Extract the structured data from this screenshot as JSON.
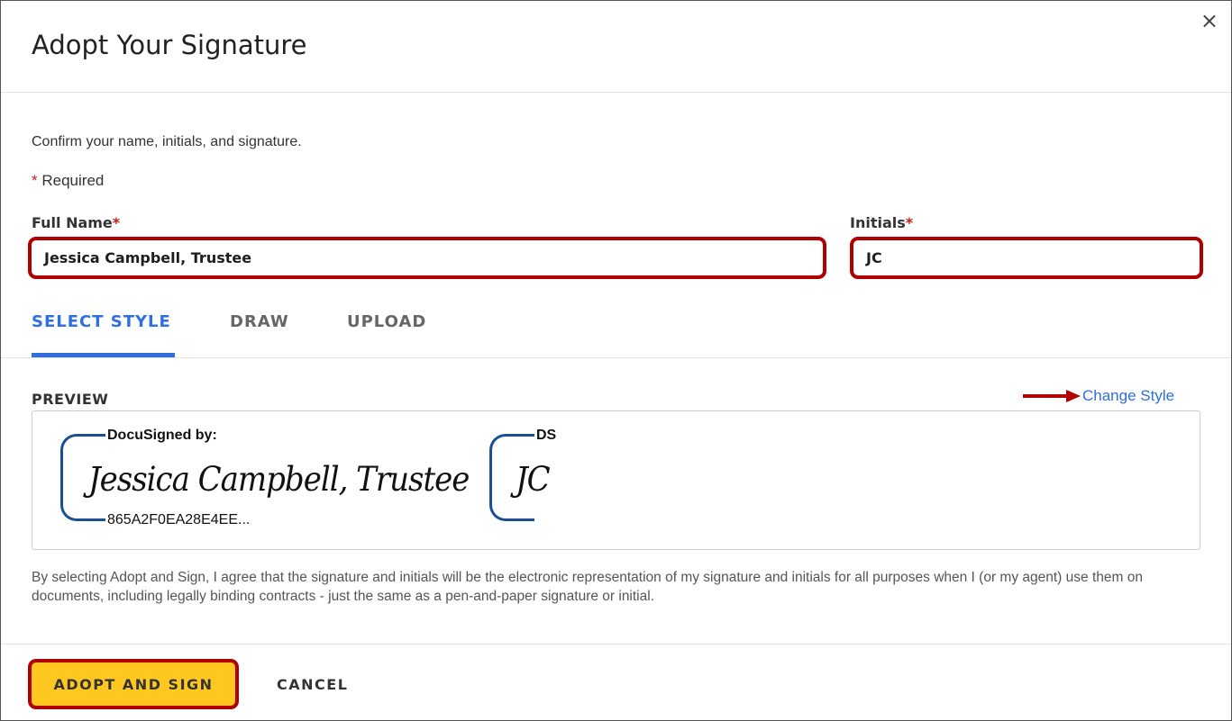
{
  "dialog": {
    "title": "Adopt Your Signature",
    "close_icon": "×"
  },
  "intro": "Confirm your name, initials, and signature.",
  "required": {
    "star": "*",
    "label": "Required"
  },
  "fields": {
    "full_name": {
      "label": "Full Name",
      "star": "*",
      "value": "Jessica Campbell, Trustee"
    },
    "initials": {
      "label": "Initials",
      "star": "*",
      "value": "JC"
    }
  },
  "tabs": [
    {
      "label": "SELECT STYLE",
      "active": true
    },
    {
      "label": "DRAW"
    },
    {
      "label": "UPLOAD"
    }
  ],
  "preview": {
    "label": "PREVIEW",
    "change_style": "Change Style",
    "signature": {
      "header": "DocuSigned by:",
      "text": "Jessica Campbell, Trustee",
      "id": "865A2F0EA28E4EE..."
    },
    "initials": {
      "header": "DS",
      "text": "JC"
    }
  },
  "legal": "By selecting Adopt and Sign, I agree that the signature and initials will be the electronic representation of my signature and initials for all purposes when I (or my agent) use them on documents, including legally binding contracts - just the same as a pen-and-paper signature or initial.",
  "buttons": {
    "adopt": "ADOPT AND SIGN",
    "cancel": "CANCEL"
  },
  "colors": {
    "accent": "#2f6fe0",
    "highlight": "#b10000",
    "primary_button": "#ffc820",
    "bracket": "#1b4f93"
  }
}
